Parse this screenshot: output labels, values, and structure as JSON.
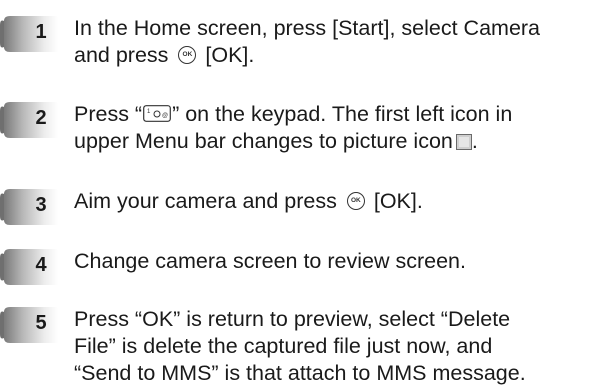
{
  "steps": [
    {
      "number": "1",
      "line1_a": "In the Home screen, press [Start], select Camera",
      "line2_a": "and press",
      "line2_b": "[OK]."
    },
    {
      "number": "2",
      "line1_a": "Press “",
      "line1_b": "” on the keypad. The first left icon in",
      "line2_a": "upper Menu bar changes to picture icon",
      "line2_b": "."
    },
    {
      "number": "3",
      "line1_a": "Aim your camera and press",
      "line1_b": "[OK]."
    },
    {
      "number": "4",
      "line1_a": "Change camera screen to review screen."
    },
    {
      "number": "5",
      "line1_a": "Press “OK” is return to preview, select “Delete",
      "line2_a": "File” is delete the captured file just now, and",
      "line3_a": "“Send to MMS” is that attach to MMS message."
    }
  ],
  "icons": {
    "ok_icon_label": "OK",
    "keypad_icon_name": "keypad-camera-key-icon",
    "picture_icon_name": "picture-icon",
    "badge_icon_name": "step-number-badge"
  },
  "colors": {
    "text": "#1a1a1a",
    "badge_light": "#f2f2f2",
    "badge_dark": "#8c8c8c"
  }
}
